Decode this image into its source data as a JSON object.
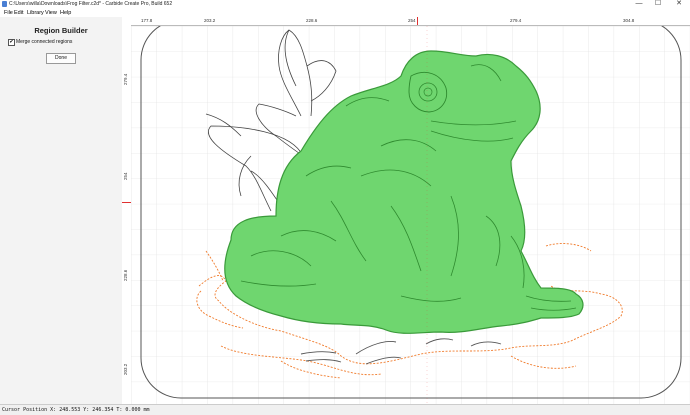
{
  "window": {
    "title": "C:\\Users\\willa\\Downloads\\Frog Filter.c2d* - Carbide Create Pro, Build 652",
    "minimize": "—",
    "maximize": "☐",
    "close": "✕"
  },
  "menu": [
    "File",
    "Edit",
    "Library",
    "View",
    "Help"
  ],
  "panel": {
    "title": "Region Builder",
    "checkbox_label": "Merge connected regions",
    "checkbox_checked": "✔",
    "done_label": "Done"
  },
  "ruler": {
    "top": [
      "177.8",
      "203.2",
      "228.6",
      "254",
      "279.4",
      "304.8"
    ],
    "left": [
      "279.4",
      "254",
      "228.6",
      "203.2"
    ]
  },
  "status": {
    "text": "Cursor Position X: 248.553 Y: 246.354 T: 0.000 mm"
  },
  "colors": {
    "selection_fill": "#6fd66f",
    "selection_stroke": "#3a9a3a",
    "grid": "#dcdcdc",
    "outline_orange": "#f07a2a",
    "ruler_marker": "#e03030"
  },
  "icons": [
    "app-icon",
    "checkbox-icon",
    "minimize-icon",
    "maximize-icon",
    "close-icon"
  ]
}
